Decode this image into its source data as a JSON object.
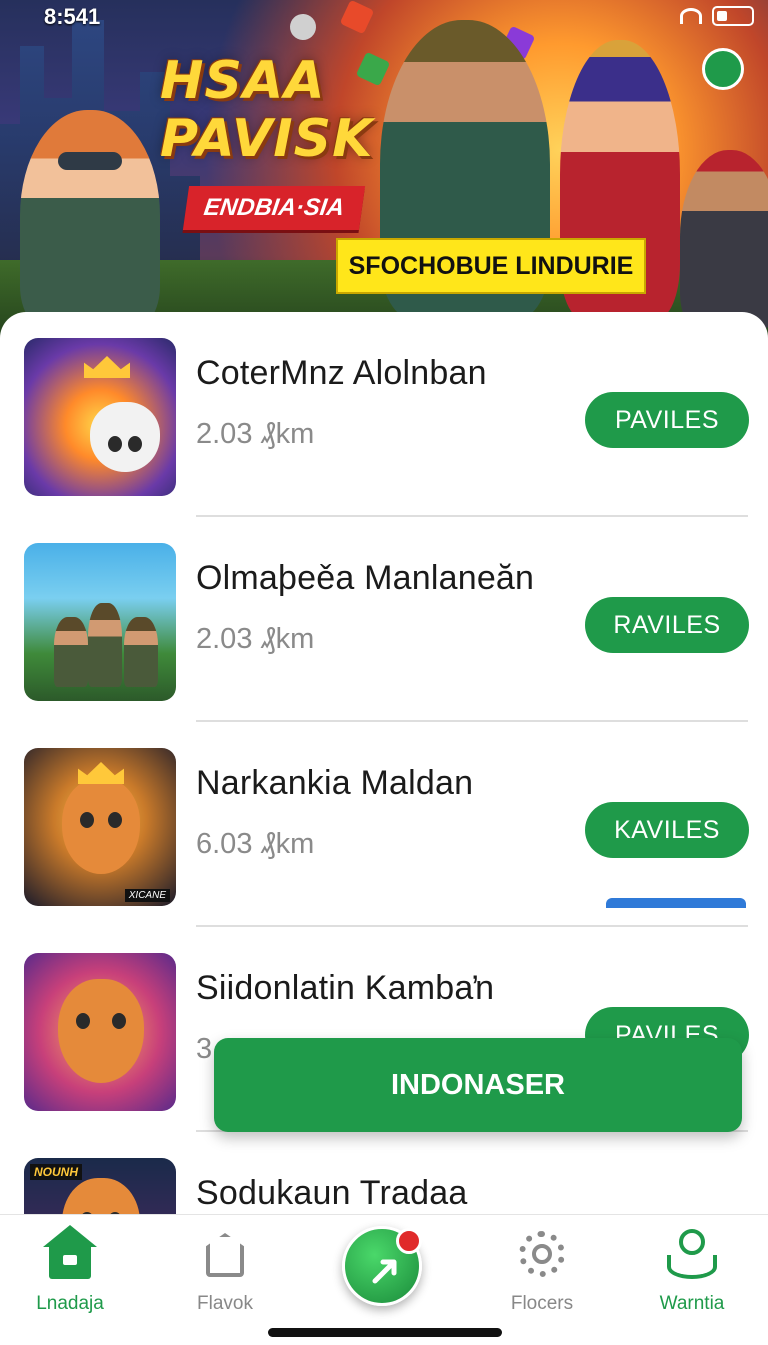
{
  "status_bar": {
    "time": "8:541"
  },
  "banner": {
    "title_line1": "HSAA",
    "title_line2": "PAVISK",
    "ribbon": "ENDBIA·SIA",
    "cta": "SFOCHOBUE LINDURIE"
  },
  "games": [
    {
      "title": "CoterMnz Alolnban",
      "subtitle": "2.03 ₰km",
      "button": "PAVILES"
    },
    {
      "title": "Olmaþeěa Manlaneăn",
      "subtitle": "2.03 ₰km",
      "button": "RAVILES"
    },
    {
      "title": "Narkankia Maldan",
      "subtitle": "6.03 ₰km",
      "button": "KAVILES",
      "thumb_tag": "XICANE"
    },
    {
      "title": "Siidonlatin Kambaŉ",
      "subtitle": "3",
      "button": "PAVILES"
    },
    {
      "title": "Sodukaun Tradaa",
      "subtitle": "",
      "button": "",
      "thumb_tag": "NOUNH"
    }
  ],
  "floating_button": "INDONASER",
  "bottom_nav": [
    {
      "label": "Lnadaja",
      "icon": "home-icon",
      "active": true
    },
    {
      "label": "Flavok",
      "icon": "house-outline-icon",
      "active": false
    },
    {
      "label": "Flocers",
      "icon": "gear-icon",
      "active": false
    },
    {
      "label": "Warntia",
      "icon": "person-icon",
      "active": true
    }
  ],
  "colors": {
    "accent": "#1f9a4a",
    "cta_yellow": "#ffe61a",
    "ribbon_red": "#d8232a"
  }
}
